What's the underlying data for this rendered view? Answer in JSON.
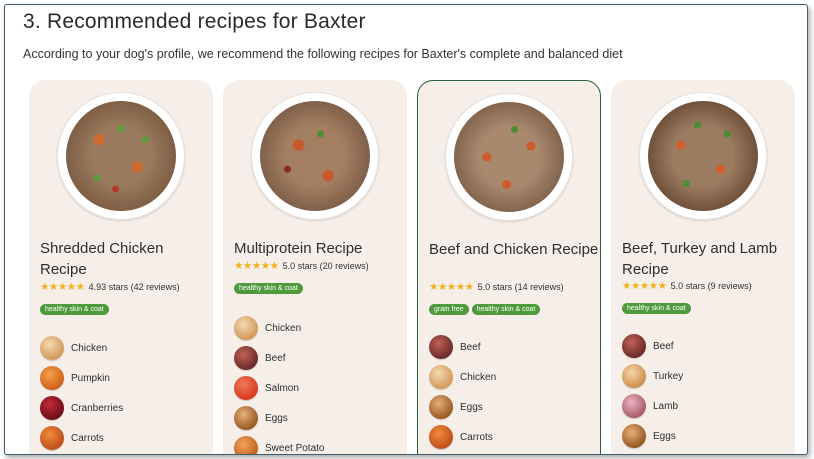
{
  "header": {
    "title": "3. Recommended recipes for Baxter",
    "subtitle": "According to your dog's profile, we recommend the following recipes for Baxter's complete and balanced diet"
  },
  "colors": {
    "card_bg": "#f6efe9",
    "tag_green": "#4f9a3c",
    "star_gold": "#f2b01e",
    "selected_border": "#2f5d3a"
  },
  "recipes": [
    {
      "name": "Shredded Chicken Recipe",
      "stars": "★★★★★",
      "rating_text": "4.93 stars (42 reviews)",
      "tags": [
        "healthy skin & coat"
      ],
      "selected": false,
      "ingredients": [
        {
          "label": "Chicken",
          "icon": "chicken-icon"
        },
        {
          "label": "Pumpkin",
          "icon": "pumpkin-icon"
        },
        {
          "label": "Cranberries",
          "icon": "cranberries-icon"
        },
        {
          "label": "Carrots",
          "icon": "carrots-icon"
        }
      ]
    },
    {
      "name": "Multiprotein Recipe",
      "stars": "★★★★★",
      "rating_text": "5.0 stars (20 reviews)",
      "tags": [
        "healthy skin & coat"
      ],
      "selected": false,
      "ingredients": [
        {
          "label": "Chicken",
          "icon": "chicken-icon"
        },
        {
          "label": "Beef",
          "icon": "beef-icon"
        },
        {
          "label": "Salmon",
          "icon": "salmon-icon"
        },
        {
          "label": "Eggs",
          "icon": "eggs-icon"
        },
        {
          "label": "Sweet Potato",
          "icon": "sweet-potato-icon"
        }
      ]
    },
    {
      "name": "Beef and Chicken Recipe",
      "stars": "★★★★★",
      "rating_text": "5.0 stars (14 reviews)",
      "tags": [
        "grain free",
        "healthy skin & coat"
      ],
      "selected": true,
      "ingredients": [
        {
          "label": "Beef",
          "icon": "beef-icon"
        },
        {
          "label": "Chicken",
          "icon": "chicken-icon"
        },
        {
          "label": "Eggs",
          "icon": "eggs-icon"
        },
        {
          "label": "Carrots",
          "icon": "carrots-icon"
        }
      ]
    },
    {
      "name": "Beef, Turkey and Lamb Recipe",
      "stars": "★★★★★",
      "rating_text": "5.0 stars (9 reviews)",
      "tags": [
        "healthy skin & coat"
      ],
      "selected": false,
      "ingredients": [
        {
          "label": "Beef",
          "icon": "beef-icon"
        },
        {
          "label": "Turkey",
          "icon": "turkey-icon"
        },
        {
          "label": "Lamb",
          "icon": "lamb-icon"
        },
        {
          "label": "Eggs",
          "icon": "eggs-icon"
        }
      ]
    }
  ]
}
